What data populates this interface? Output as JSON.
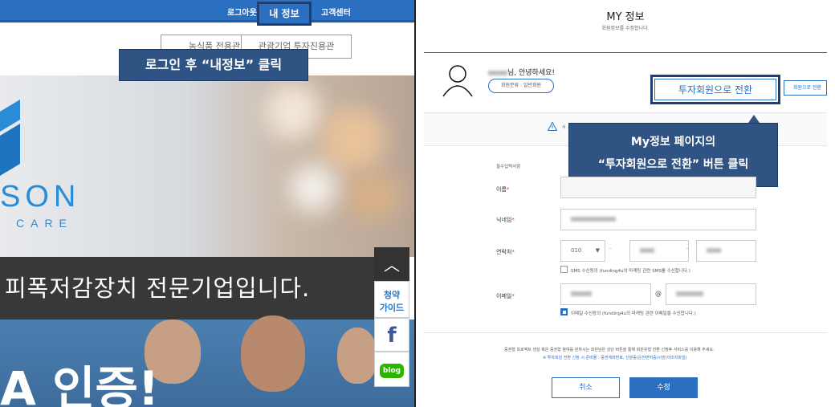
{
  "left": {
    "topnav": {
      "logout": "로그아웃",
      "myinfo": "내 정보",
      "support": "고객센터"
    },
    "menu": {
      "btn1": "농식품 전용관",
      "btn2": "관광기업 투자진용관"
    },
    "callout": "로그인 후 “내정보” 클릭",
    "logo": {
      "word1": "SON",
      "word2": "CARE"
    },
    "banner": "피폭저감장치  전문기업입니다.",
    "bigtext": "A 인증!",
    "side": {
      "up": "︿",
      "guide1": "청약",
      "guide2": "가이드",
      "facebook": "f",
      "blog": "blog"
    }
  },
  "right": {
    "title": "MY 정보",
    "subtitle": "회원정보를 수정합니다.",
    "greeting": "님, 안녕하세요!",
    "member_type": "회원분류 : 일반회원",
    "convert_button": "투자회원으로 전환",
    "convert_button_small": "회원으로 전환",
    "notice_prefix": "서",
    "callout_line1": "My정보 페이지의",
    "callout_line2": "“투자회원으로 전환” 버튼 클릭",
    "section_label": "필수입력사항",
    "labels": {
      "name": "이름",
      "nickname": "닉네임",
      "phone": "연락처",
      "email": "이메일"
    },
    "phone_prefix": "010",
    "dash": "-",
    "at": "@",
    "sms": "SMS 수신동의 (funding4u의 마케팅 관련 SMS를 수신합니다.)",
    "email_agree": "이메일 수신동의 (funding4u의 마케팅 관련 이메일을 수신합니다.)",
    "footer1": "증권형 프로젝트 생성 혹은 증권형 참여를 원하시는 회원님은 상단 버튼을 통해 회원유형 전환 신청후 서비스를 이용해 주세요.",
    "footer2": "※ 투자회원 전환 신청 시 준비물 : 증권계좌번호, 신분증(운전면허증/시번(이미지파일)",
    "cancel": "취소",
    "save": "수정"
  }
}
